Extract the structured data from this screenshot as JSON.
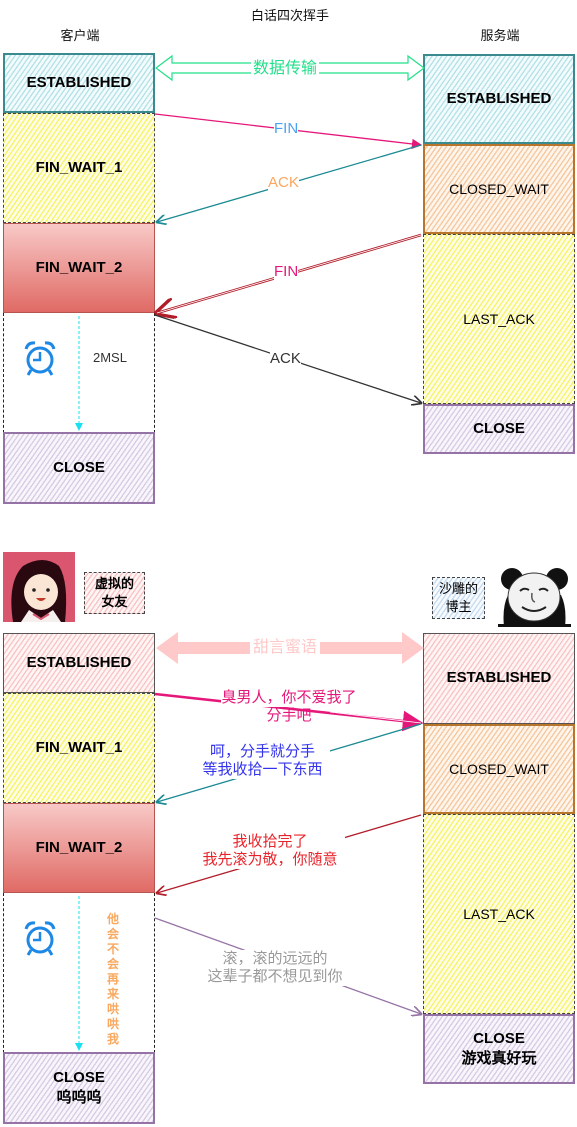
{
  "top": {
    "title": "白话四次挥手",
    "client_label": "客户端",
    "server_label": "服务端",
    "data_transfer_label": "数据传输",
    "client_states": [
      "ESTABLISHED",
      "FIN_WAIT_1",
      "FIN_WAIT_2",
      "CLOSE"
    ],
    "server_states": [
      "ESTABLISHED",
      "CLOSED_WAIT",
      "LAST_ACK",
      "CLOSE"
    ],
    "messages": [
      {
        "label": "FIN",
        "from": "client",
        "color": "#e6177a",
        "label_color": "#4aa3f0"
      },
      {
        "label": "ACK",
        "from": "server",
        "color": "#1b8a93",
        "label_color": "#f9a860"
      },
      {
        "label": "FIN",
        "from": "server",
        "color": "#b11e2a",
        "label_color": "#e6177a"
      },
      {
        "label": "ACK",
        "from": "client",
        "color": "#333333",
        "label_color": "#333333"
      }
    ],
    "timer_label": "2MSL",
    "timer_icon": "alarm-clock-icon"
  },
  "bottom": {
    "client_avatar": "girl-avatar",
    "client_caption": [
      "虚拟的",
      "女友"
    ],
    "server_avatar": "panda-meme-avatar",
    "server_caption": [
      "沙雕的",
      "博主"
    ],
    "data_transfer_label": "甜言蜜语",
    "client_states": [
      "ESTABLISHED",
      "FIN_WAIT_1",
      "FIN_WAIT_2",
      "CLOSE"
    ],
    "client_close_sub": "呜呜呜",
    "server_states": [
      "ESTABLISHED",
      "CLOSED_WAIT",
      "LAST_ACK",
      "CLOSE"
    ],
    "server_close_sub": "游戏真好玩",
    "messages": [
      {
        "lines": [
          "臭男人，你不爱我了",
          "分手吧"
        ],
        "color": "#e6177a",
        "label_color": "#e6177a"
      },
      {
        "lines": [
          "呵，分手就分手",
          "等我收拾一下东西"
        ],
        "color": "#1b8a93",
        "label_color": "#3333ee"
      },
      {
        "lines": [
          "我收拾完了",
          "我先滚为敬，你随意"
        ],
        "color": "#b11e2a",
        "label_color": "#e8242b"
      },
      {
        "lines": [
          "滚，滚的远远的",
          "这辈子都不想见到你"
        ],
        "color": "#9673a6",
        "label_color": "#999999"
      }
    ],
    "wait_note": "他会不会再来哄哄我",
    "timer_icon": "alarm-clock-icon"
  },
  "colors": {
    "teal_state": "#3a8a8f",
    "yellow_state": "#f7f36a",
    "red_state": "#e06a65",
    "purple_state": "#9673a6",
    "orange_state": "#b8762c",
    "pink_state": "#f8c6c6",
    "data_arrow_green": "#22e08a",
    "data_arrow_pink": "#ffc9c9",
    "timer_blue": "#1e88e5",
    "timer_line": "#19e0f0",
    "note_orange": "#f9a860"
  }
}
